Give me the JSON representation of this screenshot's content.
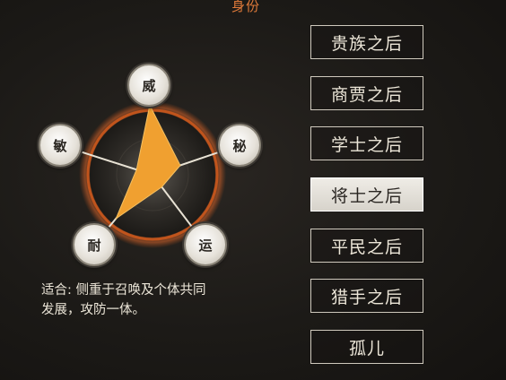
{
  "header": {
    "title": "身份"
  },
  "radar": {
    "attributes": [
      {
        "label": "威",
        "value": 1.0
      },
      {
        "label": "秘",
        "value": 0.42
      },
      {
        "label": "运",
        "value": 0.22
      },
      {
        "label": "耐",
        "value": 0.82
      },
      {
        "label": "敏",
        "value": 0.24
      }
    ],
    "fill_color": "#f0a030",
    "ring_color": "#c0541c"
  },
  "description": {
    "line1": "适合: 侧重于召唤及个体共同",
    "line2": "发展，攻防一体。"
  },
  "backgrounds": [
    {
      "label": "贵族之后",
      "selected": false
    },
    {
      "label": "商贾之后",
      "selected": false
    },
    {
      "label": "学士之后",
      "selected": false
    },
    {
      "label": "将士之后",
      "selected": true
    },
    {
      "label": "平民之后",
      "selected": false
    },
    {
      "label": "猎手之后",
      "selected": false
    },
    {
      "label": "孤儿",
      "selected": false
    }
  ]
}
